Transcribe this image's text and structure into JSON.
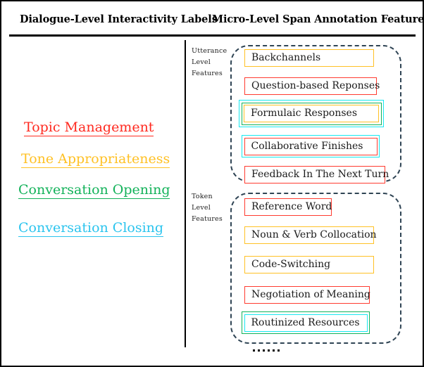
{
  "figure": {
    "headers": {
      "left": "Dialogue-Level Interactivity Labels",
      "right": "Micro-Level Span Annotation Features"
    },
    "colors": {
      "red": "#FF3B30",
      "gold": "#FFC125",
      "green": "#13B25A",
      "cyan": "#17E8F0",
      "dashed": "#2F4454",
      "frame": "#000000"
    }
  },
  "dialogue_labels": [
    {
      "text": "Topic Management",
      "color": "#FF2A20"
    },
    {
      "text": "Tone Appropriateness",
      "color": "#FFC125"
    },
    {
      "text": "Conversation Opening",
      "color": "#13B25A"
    },
    {
      "text": "Conversation Closing",
      "color": "#2BC4EE"
    }
  ],
  "groups": [
    {
      "label_lines": "Utterance\nLevel\nFeatures",
      "label_line1": "Utterance",
      "label_line2": "Level",
      "label_line3": "Features",
      "features": [
        {
          "text": "Backchannels",
          "borders": [
            "#FFC125"
          ]
        },
        {
          "text": "Question-based Reponses",
          "borders": [
            "#FF3B30"
          ]
        },
        {
          "text": "Formulaic Responses",
          "borders": [
            "#17E8F0",
            "#13B25A",
            "#FFC125"
          ]
        },
        {
          "text": "Collaborative Finishes",
          "borders": [
            "#17E8F0",
            "#FF3B30"
          ]
        },
        {
          "text": "Feedback In The Next Turn",
          "borders": [
            "#FF3B30"
          ]
        }
      ]
    },
    {
      "label_lines": "Token\nLevel\nFeatures",
      "label_line1": "Token",
      "label_line2": "Level",
      "label_line3": "Features",
      "features": [
        {
          "text": "Reference Word",
          "borders": [
            "#FF3B30"
          ]
        },
        {
          "text": "Noun & Verb Collocation",
          "borders": [
            "#FFC125"
          ]
        },
        {
          "text": "Code-Switching",
          "borders": [
            "#FFC125"
          ]
        },
        {
          "text": "Negotiation of Meaning",
          "borders": [
            "#FF3B30"
          ]
        },
        {
          "text": "Routinized Resources",
          "borders": [
            "#13B25A",
            "#17E8F0"
          ]
        }
      ]
    }
  ],
  "ellipsis_dots": 6
}
